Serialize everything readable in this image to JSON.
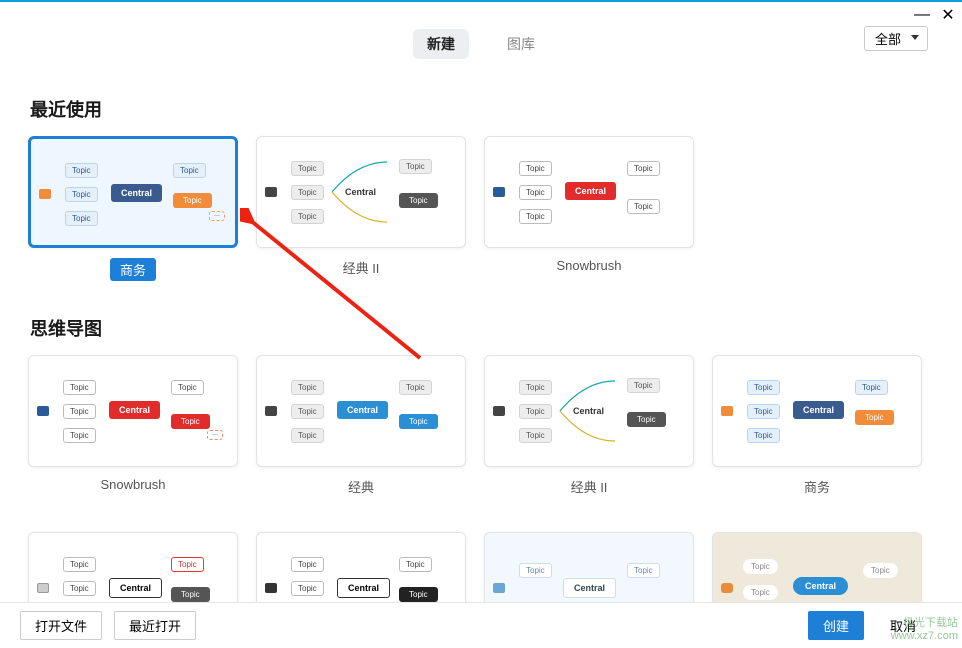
{
  "window": {
    "titlebar": {
      "minimize": "—",
      "close": "✕"
    }
  },
  "header": {
    "tabs": [
      {
        "label": "新建",
        "active": true
      },
      {
        "label": "图库",
        "active": false
      }
    ],
    "category": "全部"
  },
  "sections": {
    "recent": {
      "title": "最近使用",
      "items": [
        {
          "label": "商务",
          "variant": "business",
          "selected": true
        },
        {
          "label": "经典 II",
          "variant": "classic2",
          "selected": false
        },
        {
          "label": "Snowbrush",
          "variant": "snowbrush-red",
          "selected": false
        }
      ]
    },
    "mindmap": {
      "title": "思维导图",
      "items": [
        {
          "label": "Snowbrush",
          "variant": "snowbrush-red"
        },
        {
          "label": "经典",
          "variant": "classic-blue"
        },
        {
          "label": "经典 II",
          "variant": "classic2"
        },
        {
          "label": "商务",
          "variant": "business"
        },
        {
          "label": "",
          "variant": "plain1"
        },
        {
          "label": "",
          "variant": "plain2"
        },
        {
          "label": "",
          "variant": "soft-blue"
        },
        {
          "label": "",
          "variant": "bubble-blue"
        }
      ]
    }
  },
  "preview": {
    "central": "Central",
    "topic": "Topic"
  },
  "footer": {
    "open_file": "打开文件",
    "recent_open": "最近打开",
    "create": "创建",
    "cancel": "取消"
  },
  "watermark": {
    "l1": "极光下载站",
    "l2": "www.xz7.com"
  }
}
